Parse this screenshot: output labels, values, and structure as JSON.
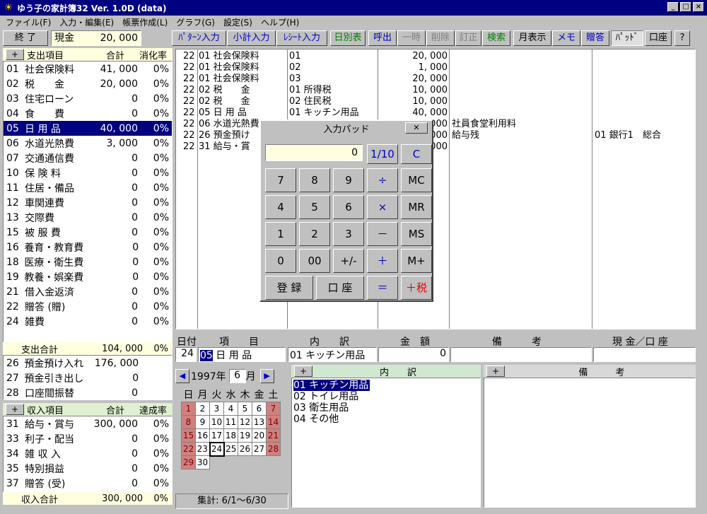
{
  "window": {
    "title": "ゆう子の家計簿32  Ver. 1.0D  (data)"
  },
  "menu": [
    "ファイル(F)",
    "入力・編集(E)",
    "帳票作成(L)",
    "グラフ(G)",
    "設定(S)",
    "ヘルプ(H)"
  ],
  "toolbar": {
    "exit": "終 了",
    "account": "現金",
    "balance": "20, 000",
    "buttons": [
      "ﾊﾟﾀｰﾝ入力",
      "小計入力",
      "ﾚｼｰﾄ入力",
      "日別表",
      "呼出",
      "一時",
      "削除",
      "訂正",
      "検索",
      "月表示",
      "メモ",
      "贈答",
      "ﾊﾟｯﾄﾞ",
      "口座",
      "?"
    ]
  },
  "expense": {
    "header": {
      "plus": "+",
      "item": "支出項目",
      "total": "合計",
      "rate": "消化率"
    },
    "items": [
      {
        "code": "01",
        "name": "社会保険料",
        "amount": "41, 000",
        "pct": "0%"
      },
      {
        "code": "02",
        "name": "税　　金",
        "amount": "20, 000",
        "pct": "0%"
      },
      {
        "code": "03",
        "name": "住宅ローン",
        "amount": "0",
        "pct": "0%"
      },
      {
        "code": "04",
        "name": "食　　費",
        "amount": "0",
        "pct": "0%"
      },
      {
        "code": "05",
        "name": "日 用 品",
        "amount": "40, 000",
        "pct": "0%"
      },
      {
        "code": "06",
        "name": "水道光熱費",
        "amount": "3, 000",
        "pct": "0%"
      },
      {
        "code": "07",
        "name": "交通通信費",
        "amount": "0",
        "pct": "0%"
      },
      {
        "code": "10",
        "name": "保 険 料",
        "amount": "0",
        "pct": "0%"
      },
      {
        "code": "11",
        "name": "住居・備品",
        "amount": "0",
        "pct": "0%"
      },
      {
        "code": "12",
        "name": "車関連費",
        "amount": "0",
        "pct": "0%"
      },
      {
        "code": "13",
        "name": "交際費",
        "amount": "0",
        "pct": "0%"
      },
      {
        "code": "15",
        "name": "被 服 費",
        "amount": "0",
        "pct": "0%"
      },
      {
        "code": "16",
        "name": "養育・教育費",
        "amount": "0",
        "pct": "0%"
      },
      {
        "code": "18",
        "name": "医療・衛生費",
        "amount": "0",
        "pct": "0%"
      },
      {
        "code": "19",
        "name": "教養・娯楽費",
        "amount": "0",
        "pct": "0%"
      },
      {
        "code": "21",
        "name": "借入金返済",
        "amount": "0",
        "pct": "0%"
      },
      {
        "code": "22",
        "name": "贈答 (贈)",
        "amount": "0",
        "pct": "0%"
      },
      {
        "code": "24",
        "name": "雑費",
        "amount": "0",
        "pct": "0%"
      }
    ],
    "total_label": "支出合計",
    "total": "104, 000",
    "total_pct": "0%"
  },
  "transfers": [
    {
      "code": "26",
      "name": "預金預け入れ",
      "amount": "176, 000"
    },
    {
      "code": "27",
      "name": "預金引き出し",
      "amount": "0"
    },
    {
      "code": "28",
      "name": "口座間振替",
      "amount": "0"
    }
  ],
  "income": {
    "header": {
      "plus": "+",
      "item": "収入項目",
      "total": "合計",
      "rate": "達成率"
    },
    "items": [
      {
        "code": "31",
        "name": "給与・賞与",
        "amount": "300, 000",
        "pct": "0%"
      },
      {
        "code": "33",
        "name": "利子・配当",
        "amount": "0",
        "pct": "0%"
      },
      {
        "code": "34",
        "name": "雑 収 入",
        "amount": "0",
        "pct": "0%"
      },
      {
        "code": "35",
        "name": "特別損益",
        "amount": "0",
        "pct": "0%"
      },
      {
        "code": "37",
        "name": "贈答 (受)",
        "amount": "0",
        "pct": "0%"
      }
    ],
    "total_label": "収入合計",
    "total": "300, 000",
    "total_pct": "0%"
  },
  "ledger": [
    {
      "day": "22",
      "item": "01 社会保険料",
      "detail": "01",
      "amount": "20, 000",
      "note": "",
      "acct": ""
    },
    {
      "day": "22",
      "item": "01 社会保険料",
      "detail": "02",
      "amount": "1, 000",
      "note": "",
      "acct": ""
    },
    {
      "day": "22",
      "item": "01 社会保険料",
      "detail": "03",
      "amount": "20, 000",
      "note": "",
      "acct": ""
    },
    {
      "day": "22",
      "item": "02 税　　金",
      "detail": "01 所得税",
      "amount": "10, 000",
      "note": "",
      "acct": ""
    },
    {
      "day": "22",
      "item": "02 税　　金",
      "detail": "02 住民税",
      "amount": "10, 000",
      "note": "",
      "acct": ""
    },
    {
      "day": "22",
      "item": "05 日 用 品",
      "detail": "01 キッチン用品",
      "amount": "40, 000",
      "note": "",
      "acct": ""
    },
    {
      "day": "22",
      "item": "06 水道光熱費",
      "detail": "",
      "amount": "000",
      "note": "社員食堂利用料",
      "acct": ""
    },
    {
      "day": "22",
      "item": "26 預金預け",
      "detail": "",
      "amount": "000",
      "note": "給与残",
      "acct": "01 銀行1　総合"
    },
    {
      "day": "22",
      "item": "31 給与・賞",
      "detail": "",
      "amount": "000",
      "note": "",
      "acct": ""
    }
  ],
  "entry": {
    "headers": [
      "日付",
      "項　　目",
      "内　　訳",
      "金　額",
      "備　　　考",
      "現 金／口 座"
    ],
    "day": "24",
    "item_code": "05",
    "item_name": "日 用 品",
    "detail": "01 キッチン用品",
    "amount": "0",
    "note": "",
    "account": ""
  },
  "calendar": {
    "year": "1997年",
    "month": "6",
    "month_suffix": "月",
    "weekdays": [
      "日",
      "月",
      "火",
      "水",
      "木",
      "金",
      "土"
    ],
    "weeks": [
      [
        "1",
        "2",
        "3",
        "4",
        "5",
        "6",
        "7"
      ],
      [
        "8",
        "9",
        "10",
        "11",
        "12",
        "13",
        "14"
      ],
      [
        "15",
        "16",
        "17",
        "18",
        "19",
        "20",
        "21"
      ],
      [
        "22",
        "23",
        "24",
        "25",
        "26",
        "27",
        "28"
      ],
      [
        "29",
        "30",
        "",
        "",
        "",
        "",
        ""
      ]
    ],
    "today": "24",
    "summary": "集計: 6/1～6/30"
  },
  "detail_panel": {
    "plus": "+",
    "title": "内　　訳",
    "items": [
      "01 キッチン用品",
      "02 トイレ用品",
      "03 衛生用品",
      "04 その他"
    ],
    "selected": 0
  },
  "note_panel": {
    "plus": "+",
    "title": "備　　　考"
  },
  "calculator": {
    "title": "入力パッド",
    "close": "✕",
    "display": "0",
    "keys": [
      [
        "1/10",
        "C"
      ],
      [
        "7",
        "8",
        "9",
        "÷",
        "MC"
      ],
      [
        "4",
        "5",
        "6",
        "×",
        "MR"
      ],
      [
        "1",
        "2",
        "3",
        "－",
        "MS"
      ],
      [
        "0",
        "00",
        "+/-",
        "＋",
        "M+"
      ],
      [
        "登 録",
        "口 座",
        "＝",
        "＋税"
      ]
    ]
  }
}
